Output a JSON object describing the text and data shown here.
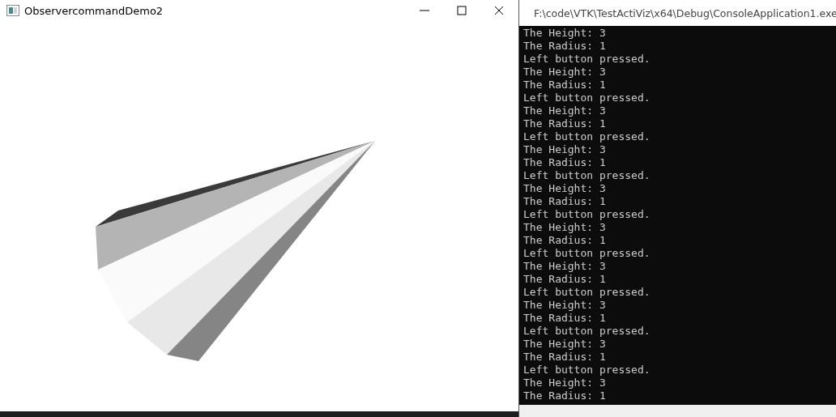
{
  "render_window": {
    "title": "ObservercommandDemo2"
  },
  "console_window": {
    "title": "F:\\code\\VTK\\TestActiViz\\x64\\Debug\\ConsoleApplication1.exe",
    "lines": [
      "The Height: 3",
      "The Radius: 1",
      "Left button pressed.",
      "The Height: 3",
      "The Radius: 1",
      "Left button pressed.",
      "The Height: 3",
      "The Radius: 1",
      "Left button pressed.",
      "The Height: 3",
      "The Radius: 1",
      "Left button pressed.",
      "The Height: 3",
      "The Radius: 1",
      "Left button pressed.",
      "The Height: 3",
      "The Radius: 1",
      "Left button pressed.",
      "The Height: 3",
      "The Radius: 1",
      "Left button pressed.",
      "The Height: 3",
      "The Radius: 1",
      "Left button pressed.",
      "The Height: 3",
      "The Radius: 1",
      "Left button pressed.",
      "The Height: 3",
      "The Radius: 1"
    ]
  }
}
